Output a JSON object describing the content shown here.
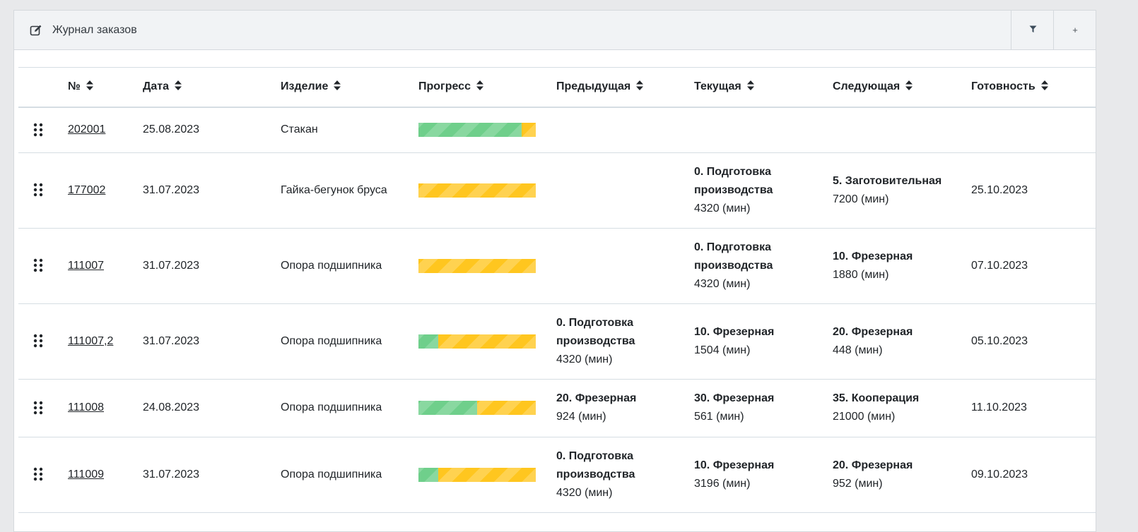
{
  "header": {
    "title": "Журнал заказов",
    "title_icon": "edit-icon",
    "filter_icon": "filter-icon",
    "add_label": "+"
  },
  "columns": [
    "№",
    "Дата",
    "Изделие",
    "Прогресс",
    "Предыдущая",
    "Текущая",
    "Следующая",
    "Готовность"
  ],
  "colors": {
    "progress_done": "#6fcf8b",
    "progress_remaining": "#ffc61f"
  },
  "rows": [
    {
      "number": "202001",
      "date": "25.08.2023",
      "product": "Стакан",
      "progress": 0.88,
      "previous": {
        "name": "",
        "time": ""
      },
      "current": {
        "name": "",
        "time": ""
      },
      "next": {
        "name": "",
        "time": ""
      },
      "ready": ""
    },
    {
      "number": "177002",
      "date": "31.07.2023",
      "product": "Гайка-бегунок бруса",
      "progress": 0,
      "previous": {
        "name": "",
        "time": ""
      },
      "current": {
        "name": "0. Подготовка производства",
        "time": "4320 (мин)"
      },
      "next": {
        "name": "5. Заготовительная",
        "time": "7200 (мин)"
      },
      "ready": "25.10.2023"
    },
    {
      "number": "111007",
      "date": "31.07.2023",
      "product": "Опора подшипника",
      "progress": 0,
      "previous": {
        "name": "",
        "time": ""
      },
      "current": {
        "name": "0. Подготовка производства",
        "time": "4320 (мин)"
      },
      "next": {
        "name": "10. Фрезерная",
        "time": "1880 (мин)"
      },
      "ready": "07.10.2023"
    },
    {
      "number": "111007,2",
      "date": "31.07.2023",
      "product": "Опора подшипника",
      "progress": 0.17,
      "previous": {
        "name": "0. Подготовка производства",
        "time": "4320 (мин)"
      },
      "current": {
        "name": "10. Фрезерная",
        "time": "1504 (мин)"
      },
      "next": {
        "name": "20. Фрезерная",
        "time": "448 (мин)"
      },
      "ready": "05.10.2023"
    },
    {
      "number": "111008",
      "date": "24.08.2023",
      "product": "Опора подшипника",
      "progress": 0.5,
      "previous": {
        "name": "20. Фрезерная",
        "time": "924 (мин)"
      },
      "current": {
        "name": "30. Фрезерная",
        "time": "561 (мин)"
      },
      "next": {
        "name": "35. Кооперация",
        "time": "21000 (мин)"
      },
      "ready": "11.10.2023"
    },
    {
      "number": "111009",
      "date": "31.07.2023",
      "product": "Опора подшипника",
      "progress": 0.17,
      "previous": {
        "name": "0. Подготовка производства",
        "time": "4320 (мин)"
      },
      "current": {
        "name": "10. Фрезерная",
        "time": "3196 (мин)"
      },
      "next": {
        "name": "20. Фрезерная",
        "time": "952 (мин)"
      },
      "ready": "09.10.2023"
    }
  ]
}
